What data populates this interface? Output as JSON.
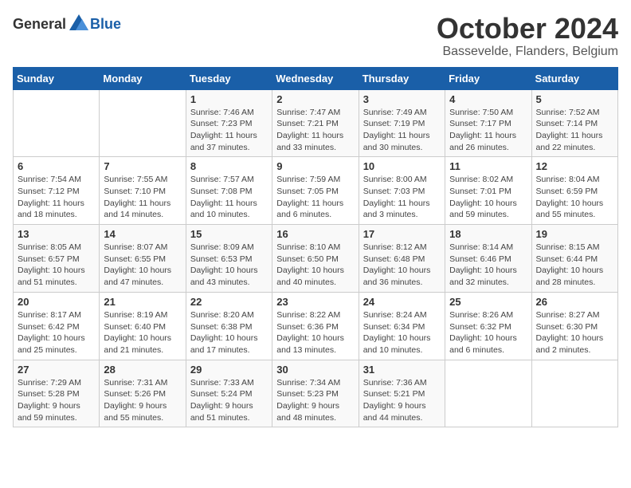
{
  "logo": {
    "general": "General",
    "blue": "Blue"
  },
  "title": "October 2024",
  "location": "Bassevelde, Flanders, Belgium",
  "days_of_week": [
    "Sunday",
    "Monday",
    "Tuesday",
    "Wednesday",
    "Thursday",
    "Friday",
    "Saturday"
  ],
  "weeks": [
    [
      {
        "day": "",
        "info": ""
      },
      {
        "day": "",
        "info": ""
      },
      {
        "day": "1",
        "info": "Sunrise: 7:46 AM\nSunset: 7:23 PM\nDaylight: 11 hours\nand 37 minutes."
      },
      {
        "day": "2",
        "info": "Sunrise: 7:47 AM\nSunset: 7:21 PM\nDaylight: 11 hours\nand 33 minutes."
      },
      {
        "day": "3",
        "info": "Sunrise: 7:49 AM\nSunset: 7:19 PM\nDaylight: 11 hours\nand 30 minutes."
      },
      {
        "day": "4",
        "info": "Sunrise: 7:50 AM\nSunset: 7:17 PM\nDaylight: 11 hours\nand 26 minutes."
      },
      {
        "day": "5",
        "info": "Sunrise: 7:52 AM\nSunset: 7:14 PM\nDaylight: 11 hours\nand 22 minutes."
      }
    ],
    [
      {
        "day": "6",
        "info": "Sunrise: 7:54 AM\nSunset: 7:12 PM\nDaylight: 11 hours\nand 18 minutes."
      },
      {
        "day": "7",
        "info": "Sunrise: 7:55 AM\nSunset: 7:10 PM\nDaylight: 11 hours\nand 14 minutes."
      },
      {
        "day": "8",
        "info": "Sunrise: 7:57 AM\nSunset: 7:08 PM\nDaylight: 11 hours\nand 10 minutes."
      },
      {
        "day": "9",
        "info": "Sunrise: 7:59 AM\nSunset: 7:05 PM\nDaylight: 11 hours\nand 6 minutes."
      },
      {
        "day": "10",
        "info": "Sunrise: 8:00 AM\nSunset: 7:03 PM\nDaylight: 11 hours\nand 3 minutes."
      },
      {
        "day": "11",
        "info": "Sunrise: 8:02 AM\nSunset: 7:01 PM\nDaylight: 10 hours\nand 59 minutes."
      },
      {
        "day": "12",
        "info": "Sunrise: 8:04 AM\nSunset: 6:59 PM\nDaylight: 10 hours\nand 55 minutes."
      }
    ],
    [
      {
        "day": "13",
        "info": "Sunrise: 8:05 AM\nSunset: 6:57 PM\nDaylight: 10 hours\nand 51 minutes."
      },
      {
        "day": "14",
        "info": "Sunrise: 8:07 AM\nSunset: 6:55 PM\nDaylight: 10 hours\nand 47 minutes."
      },
      {
        "day": "15",
        "info": "Sunrise: 8:09 AM\nSunset: 6:53 PM\nDaylight: 10 hours\nand 43 minutes."
      },
      {
        "day": "16",
        "info": "Sunrise: 8:10 AM\nSunset: 6:50 PM\nDaylight: 10 hours\nand 40 minutes."
      },
      {
        "day": "17",
        "info": "Sunrise: 8:12 AM\nSunset: 6:48 PM\nDaylight: 10 hours\nand 36 minutes."
      },
      {
        "day": "18",
        "info": "Sunrise: 8:14 AM\nSunset: 6:46 PM\nDaylight: 10 hours\nand 32 minutes."
      },
      {
        "day": "19",
        "info": "Sunrise: 8:15 AM\nSunset: 6:44 PM\nDaylight: 10 hours\nand 28 minutes."
      }
    ],
    [
      {
        "day": "20",
        "info": "Sunrise: 8:17 AM\nSunset: 6:42 PM\nDaylight: 10 hours\nand 25 minutes."
      },
      {
        "day": "21",
        "info": "Sunrise: 8:19 AM\nSunset: 6:40 PM\nDaylight: 10 hours\nand 21 minutes."
      },
      {
        "day": "22",
        "info": "Sunrise: 8:20 AM\nSunset: 6:38 PM\nDaylight: 10 hours\nand 17 minutes."
      },
      {
        "day": "23",
        "info": "Sunrise: 8:22 AM\nSunset: 6:36 PM\nDaylight: 10 hours\nand 13 minutes."
      },
      {
        "day": "24",
        "info": "Sunrise: 8:24 AM\nSunset: 6:34 PM\nDaylight: 10 hours\nand 10 minutes."
      },
      {
        "day": "25",
        "info": "Sunrise: 8:26 AM\nSunset: 6:32 PM\nDaylight: 10 hours\nand 6 minutes."
      },
      {
        "day": "26",
        "info": "Sunrise: 8:27 AM\nSunset: 6:30 PM\nDaylight: 10 hours\nand 2 minutes."
      }
    ],
    [
      {
        "day": "27",
        "info": "Sunrise: 7:29 AM\nSunset: 5:28 PM\nDaylight: 9 hours\nand 59 minutes."
      },
      {
        "day": "28",
        "info": "Sunrise: 7:31 AM\nSunset: 5:26 PM\nDaylight: 9 hours\nand 55 minutes."
      },
      {
        "day": "29",
        "info": "Sunrise: 7:33 AM\nSunset: 5:24 PM\nDaylight: 9 hours\nand 51 minutes."
      },
      {
        "day": "30",
        "info": "Sunrise: 7:34 AM\nSunset: 5:23 PM\nDaylight: 9 hours\nand 48 minutes."
      },
      {
        "day": "31",
        "info": "Sunrise: 7:36 AM\nSunset: 5:21 PM\nDaylight: 9 hours\nand 44 minutes."
      },
      {
        "day": "",
        "info": ""
      },
      {
        "day": "",
        "info": ""
      }
    ]
  ]
}
